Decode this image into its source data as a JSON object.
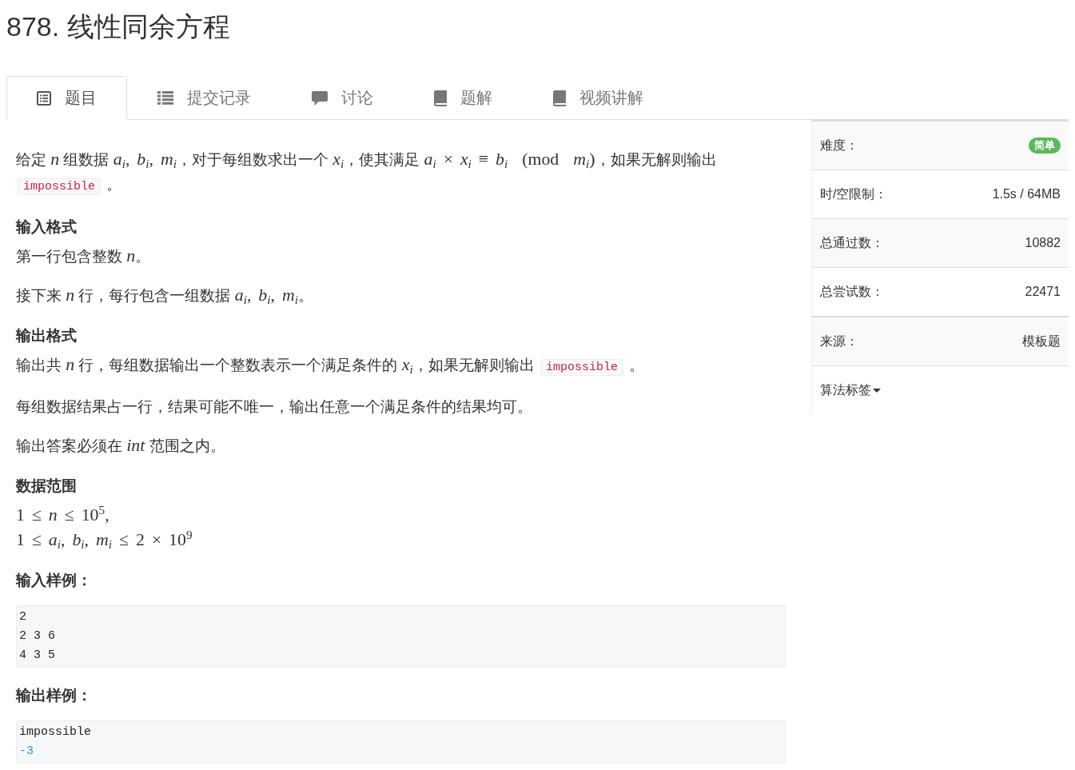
{
  "problem": {
    "title": "878. 线性同余方程"
  },
  "tabs": [
    {
      "kind": "statement",
      "label": "题目",
      "selected": true
    },
    {
      "kind": "records",
      "label": "提交记录",
      "selected": false
    },
    {
      "kind": "discussion",
      "label": "讨论",
      "selected": false
    },
    {
      "kind": "solution",
      "label": "题解",
      "selected": false
    },
    {
      "kind": "video",
      "label": "视频讲解",
      "selected": false
    }
  ],
  "statement": [
    {
      "kind": "paragraph",
      "segments": [
        {
          "kind": "text",
          "text": "给定 "
        },
        {
          "kind": "var",
          "text": "n"
        },
        {
          "kind": "text",
          "text": " 组数据 "
        },
        {
          "kind": "math",
          "text": "*a*$_{i}$, *b*$_{i}$, *m*$_{i}$"
        },
        {
          "kind": "text",
          "text": "，对于每组数求出一个 "
        },
        {
          "kind": "math",
          "text": "*x*$_{i}$"
        },
        {
          "kind": "text",
          "text": "，使其满足 "
        },
        {
          "kind": "math",
          "text": "*a*$_{i}$ × *x*$_{i}$ ≡ *b*$_{i}$  (mod  *m*$_{i}$)"
        },
        {
          "kind": "text",
          "text": "，如果无解则输出 "
        },
        {
          "kind": "code",
          "text": "impossible"
        },
        {
          "kind": "text",
          "text": " 。"
        }
      ]
    },
    {
      "kind": "heading",
      "text": "输入格式"
    },
    {
      "kind": "paragraph",
      "segments": [
        {
          "kind": "text",
          "text": "第一行包含整数 "
        },
        {
          "kind": "var",
          "text": "n"
        },
        {
          "kind": "text",
          "text": "。"
        }
      ]
    },
    {
      "kind": "paragraph",
      "segments": [
        {
          "kind": "text",
          "text": "接下来 "
        },
        {
          "kind": "var",
          "text": "n"
        },
        {
          "kind": "text",
          "text": " 行，每行包含一组数据 "
        },
        {
          "kind": "math",
          "text": "*a*$_{i}$, *b*$_{i}$, *m*$_{i}$"
        },
        {
          "kind": "text",
          "text": "。"
        }
      ]
    },
    {
      "kind": "heading",
      "text": "输出格式"
    },
    {
      "kind": "paragraph",
      "segments": [
        {
          "kind": "text",
          "text": "输出共 "
        },
        {
          "kind": "var",
          "text": "n"
        },
        {
          "kind": "text",
          "text": " 行，每组数据输出一个整数表示一个满足条件的 "
        },
        {
          "kind": "math",
          "text": "*x*$_{i}$"
        },
        {
          "kind": "text",
          "text": "，如果无解则输出 "
        },
        {
          "kind": "code",
          "text": "impossible"
        },
        {
          "kind": "text",
          "text": " 。"
        }
      ]
    },
    {
      "kind": "paragraph",
      "segments": [
        {
          "kind": "text",
          "text": "每组数据结果占一行，结果可能不唯一，输出任意一个满足条件的结果均可。"
        }
      ]
    },
    {
      "kind": "paragraph",
      "segments": [
        {
          "kind": "text",
          "text": "输出答案必须在 "
        },
        {
          "kind": "var",
          "text": "int"
        },
        {
          "kind": "text",
          "text": " 范围之内。"
        }
      ]
    },
    {
      "kind": "heading",
      "text": "数据范围"
    },
    {
      "kind": "formula",
      "text": "1 ≤ *n* ≤ 10$^{5}$,"
    },
    {
      "kind": "formula",
      "text": "1 ≤ *a*$_{i}$, *b*$_{i}$, *m*$_{i}$ ≤ 2 × 10$^{9}$"
    },
    {
      "kind": "heading",
      "text": "输入样例："
    },
    {
      "kind": "code",
      "lines": [
        {
          "kind": "plain",
          "text": "2"
        },
        {
          "kind": "plain",
          "text": "2 3 6"
        },
        {
          "kind": "plain",
          "text": "4 3 5"
        }
      ]
    },
    {
      "kind": "heading",
      "text": "输出样例："
    },
    {
      "kind": "code",
      "lines": [
        {
          "kind": "plain",
          "text": "impossible"
        },
        {
          "kind": "number",
          "text": "-3"
        }
      ]
    }
  ],
  "sidebar": {
    "groups": [
      {
        "rows": [
          {
            "kind": "badge",
            "label": "难度：",
            "value": "简单"
          },
          {
            "kind": "value",
            "label": "时/空限制：",
            "value": "1.5s / 64MB"
          },
          {
            "kind": "value",
            "label": "总通过数：",
            "value": "10882"
          },
          {
            "kind": "value",
            "label": "总尝试数：",
            "value": "22471"
          }
        ]
      },
      {
        "rows": [
          {
            "kind": "value",
            "label": "来源：",
            "value": "模板题"
          },
          {
            "kind": "dropdown",
            "label": "算法标签"
          }
        ]
      }
    ]
  }
}
